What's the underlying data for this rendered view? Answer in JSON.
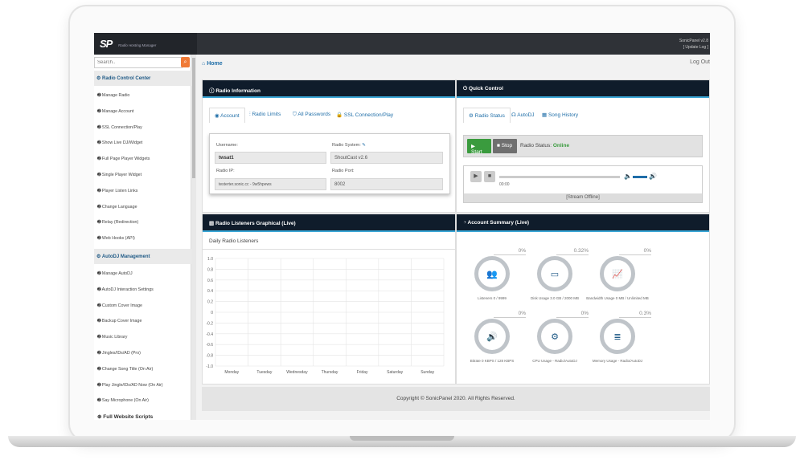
{
  "header": {
    "logo": "SP",
    "tagline": "Radio Hosting Manager",
    "version": "SonicPanel v2.8",
    "update_log": "[ Update Log ]"
  },
  "search": {
    "placeholder": "Search..",
    "icon": "search-icon"
  },
  "sidebar": {
    "section1": "Radio Control Center",
    "items1": [
      "Manage Radio",
      "Manage Account",
      "SSL Connection/Play",
      "Show Live DJ/Widget",
      "Full Page Player Widgets",
      "Single Player Widget",
      "Player Listen Links",
      "Change Language",
      "Relay (Redirection)",
      "Web Hooks (API)"
    ],
    "section2": "AutoDJ Management",
    "items2": [
      "Manage AutoDJ",
      "AutoDJ Interaction Settings",
      "Custom Cover Image",
      "Backup Cover Image",
      "Music Library",
      "Jingles/IDs/AD (Pro)",
      "Change Song Title (On Air)",
      "Play Jingle/IDs/AD Now (On Air)",
      "Say Microphone (On Air)"
    ],
    "bottom": "Full Website Scripts"
  },
  "breadcrumb": {
    "home": "Home",
    "logout": "Log Out"
  },
  "radio_info": {
    "title": "Radio Information",
    "tabs": [
      "Account",
      "Radio Limits",
      "All Passwords",
      "SSL Connection/Play"
    ],
    "username_label": "Username:",
    "username": "twsat1",
    "system_label": "Radio System:",
    "system": "ShoutCast v2.6",
    "ip_label": "Radio IP:",
    "ip": "testerter.sonic.cc - 9w5hpews",
    "port_label": "Radio Port:",
    "port": "8002"
  },
  "quick_control": {
    "title": "Quick Control",
    "tabs": [
      "Radio Status",
      "AutoDJ",
      "Song History"
    ],
    "start": "Start",
    "stop": "Stop",
    "status_label": "Radio Status:",
    "status": "Online",
    "time": "00:00",
    "stream": "[Stream Offline]"
  },
  "listeners": {
    "title": "Radio Listeners Graphical (Live)",
    "subtitle": "Daily Radio Listeners"
  },
  "account_summary": {
    "title": "Account Summary (Live)",
    "items": [
      {
        "pct": "0%",
        "label": "Listeners 0 / 9999",
        "icon": "users-icon"
      },
      {
        "pct": "0.32%",
        "label": "Disk Usage 3.0 GB / 2000 MB",
        "icon": "hdd-icon"
      },
      {
        "pct": "0%",
        "label": "Bandwidth Usage 0 MB / Unlimited MB",
        "icon": "chart-icon"
      },
      {
        "pct": "0%",
        "label": "Bitrate 0 KBPS / 128 KBPS",
        "icon": "volume-icon"
      },
      {
        "pct": "0%",
        "label": "CPU Usage - Radio/AutoDJ",
        "icon": "cog-icon"
      },
      {
        "pct": "0.3%",
        "label": "Memory Usage - Radio/AutoDJ",
        "icon": "server-icon"
      }
    ]
  },
  "chart_data": {
    "type": "line",
    "title": "Daily Radio Listeners",
    "categories": [
      "Monday",
      "Tuesday",
      "Wednesday",
      "Thursday",
      "Friday",
      "Saturday",
      "Sunday"
    ],
    "y_ticks": [
      "1.0",
      "0.8",
      "0.6",
      "0.4",
      "0.2",
      "0",
      "-0.2",
      "-0.4",
      "-0.6",
      "-0.8",
      "-1.0"
    ],
    "ylim": [
      -1.0,
      1.0
    ],
    "grid": true,
    "series": []
  },
  "footer": {
    "copyright": "Copyright © SonicPanel 2020. All Rights Reserved."
  }
}
